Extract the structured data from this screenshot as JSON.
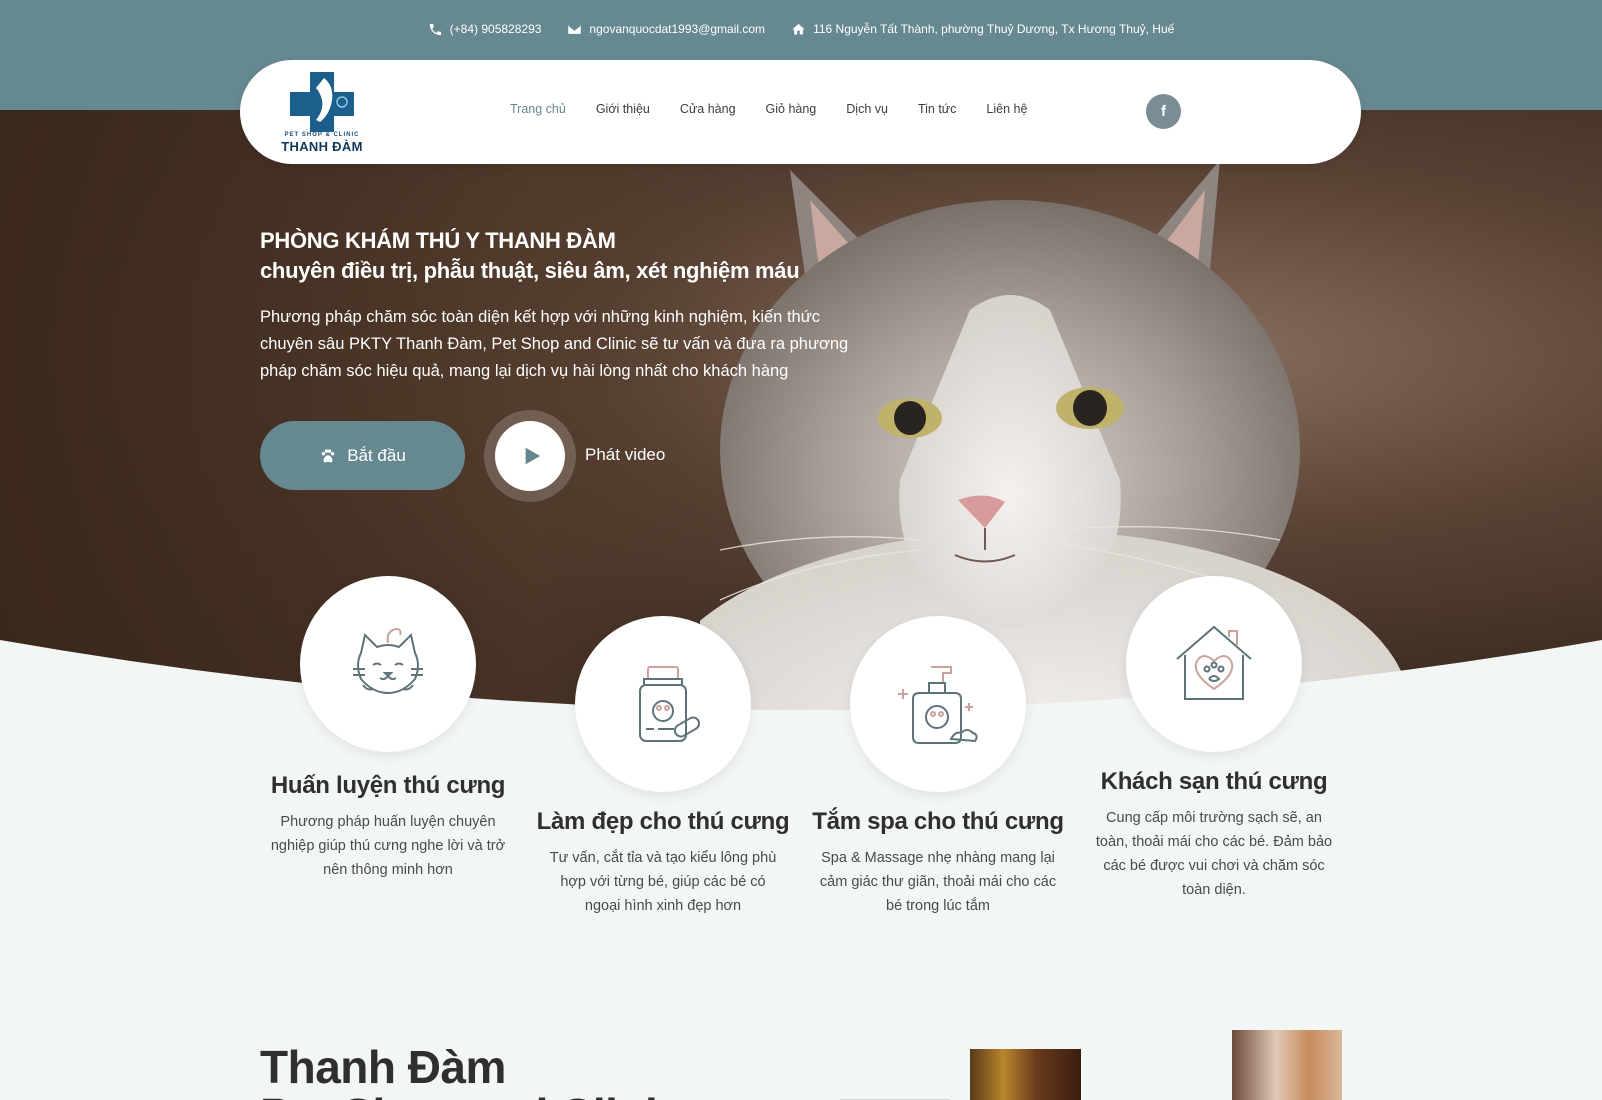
{
  "topbar": {
    "phone": "(+84) 905828293",
    "email": "ngovanquocdat1993@gmail.com",
    "address": "116 Nguyễn Tất Thành, phường Thuỷ Dương, Tx Hương Thuỷ, Huế"
  },
  "logo": {
    "tagline": "PET SHOP & CLINIC",
    "name": "THANH ĐÀM"
  },
  "nav": {
    "items": [
      {
        "label": "Trang chủ"
      },
      {
        "label": "Giới thiệu"
      },
      {
        "label": "Cửa hàng"
      },
      {
        "label": "Giỏ hàng"
      },
      {
        "label": "Dịch vụ"
      },
      {
        "label": "Tin tức"
      },
      {
        "label": "Liên hệ"
      }
    ],
    "active": "Trang chủ",
    "facebook": "f"
  },
  "hero": {
    "title": "PHÒNG KHÁM THÚ Y THANH ĐÀM",
    "subtitle": "chuyên điều trị, phẫu thuật, siêu âm, xét nghiệm máu",
    "description": "Phương pháp chăm sóc toàn diện kết hợp với những kinh nghiệm, kiến thức chuyên sâu PKTY Thanh Đàm, Pet Shop and Clinic sẽ tư vấn và đưa ra phương pháp chăm sóc hiệu quả, mang lại dịch vụ hài lòng nhất cho khách hàng",
    "start_button": "Bắt đầu",
    "video_label": "Phát video"
  },
  "services": [
    {
      "icon": "cat-icon",
      "title": "Huấn luyện thú cưng",
      "description": "Phương pháp huấn luyện chuyên nghiệp giúp thú cưng nghe lời và trở nên thông minh hơn"
    },
    {
      "icon": "medicine-bottle-icon",
      "title": "Làm đẹp cho thú cưng",
      "description": "Tư vấn, cắt tỉa và tạo kiểu lông phù hợp với từng bé, giúp các bé có ngoại hình xinh đẹp hơn"
    },
    {
      "icon": "shampoo-bottle-icon",
      "title": "Tắm spa cho thú cưng",
      "description": "Spa & Massage nhẹ nhàng mang lại cảm giác thư giãn, thoải mái cho các bé trong lúc tắm"
    },
    {
      "icon": "pet-house-icon",
      "title": "Khách sạn thú cưng",
      "description": "Cung cấp môi trường sạch sẽ, an toàn, thoải mái cho các bé. Đảm bảo các bé được vui chơi và chăm sóc toàn diện."
    }
  ],
  "about": {
    "title_line1": "Thanh Đàm",
    "title_line2": "Pet Shop and Clinic"
  },
  "colors": {
    "accent": "#668891",
    "background": "#f2f6f5",
    "text_dark": "#2f2f2f"
  }
}
